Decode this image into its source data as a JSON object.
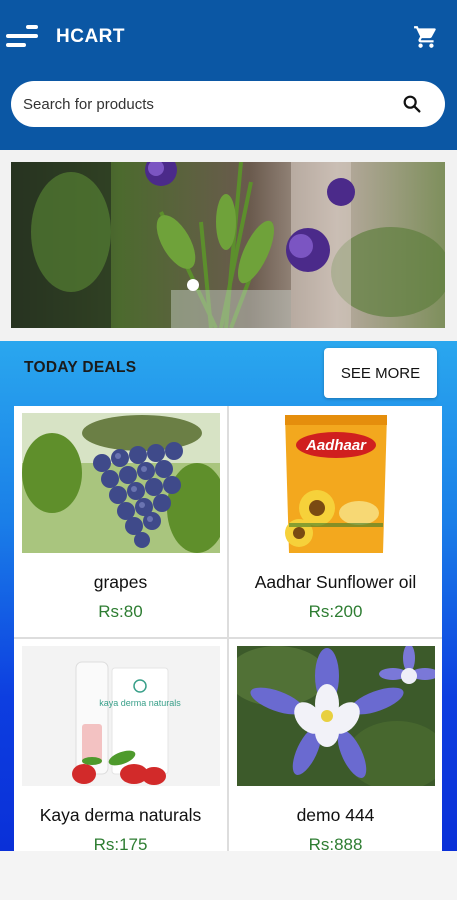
{
  "header": {
    "app_title": "HCART",
    "menu_icon": "menu-icon",
    "cart_icon": "cart-icon",
    "background": "#0b57a4"
  },
  "search": {
    "placeholder": "Search for products",
    "value": "",
    "icon": "search-icon"
  },
  "banner": {
    "image": "flowers-in-vase",
    "pager_dot": "active"
  },
  "deals": {
    "title": "TODAY DEALS",
    "see_more_label": "SEE MORE",
    "products": [
      {
        "name": "grapes",
        "price": "Rs:80",
        "image": "grapes"
      },
      {
        "name": "Aadhar Sunflower oil",
        "price": "Rs:200",
        "image": "sunflower-oil-pack",
        "pack_text": "Aadhaar"
      },
      {
        "name": "Kaya derma naturals",
        "price": "Rs:175",
        "image": "lip-balm",
        "pack_text": "kaya derma naturals"
      },
      {
        "name": "demo 444",
        "price": "Rs:888",
        "image": "blue-flowers"
      }
    ]
  },
  "colors": {
    "price": "#2e7d32",
    "deals_gradient_top": "#2aa7ee",
    "deals_gradient_bottom": "#0a30d8"
  }
}
